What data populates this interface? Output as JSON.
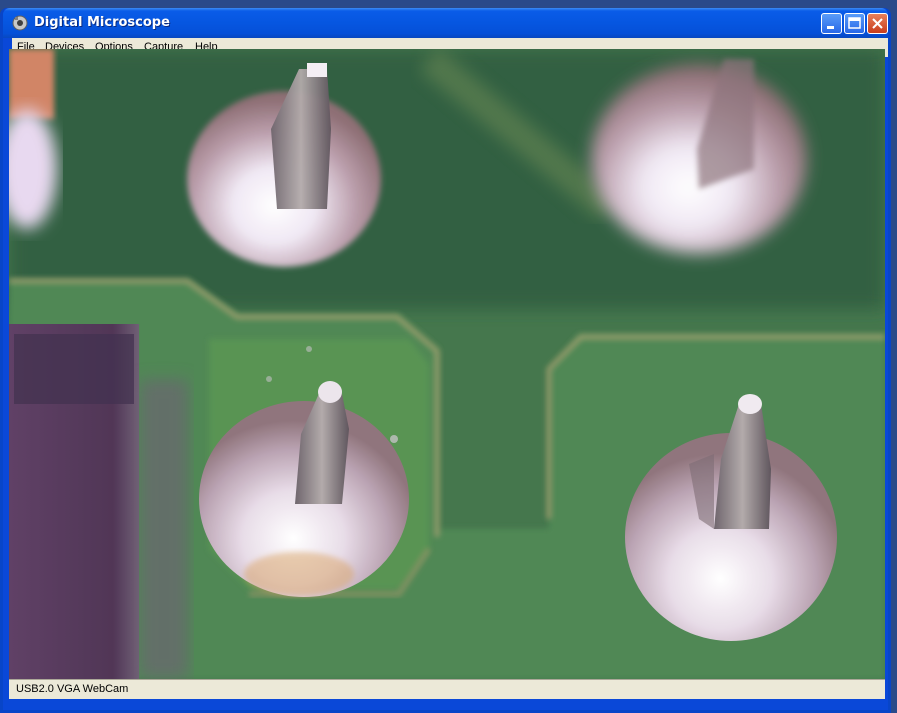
{
  "window": {
    "title": "Digital Microscope",
    "title_icon": "microscope-icon",
    "controls": [
      "minimize-icon",
      "maximize-icon",
      "close-icon"
    ]
  },
  "menubar": {
    "items": [
      {
        "label": "File"
      },
      {
        "label": "Devices"
      },
      {
        "label": "Options"
      },
      {
        "label": "Capture"
      },
      {
        "label": "Help"
      }
    ]
  },
  "viewport": {
    "content": "camera-feed-pcb-solder-joints"
  },
  "statusbar": {
    "text": "USB2.0 VGA WebCam"
  },
  "colors": {
    "titlebar": "#0656e0",
    "menubar": "#ece9d8",
    "pcb_green": "#3f7a48",
    "solder_silver": "#c8b8c8"
  }
}
